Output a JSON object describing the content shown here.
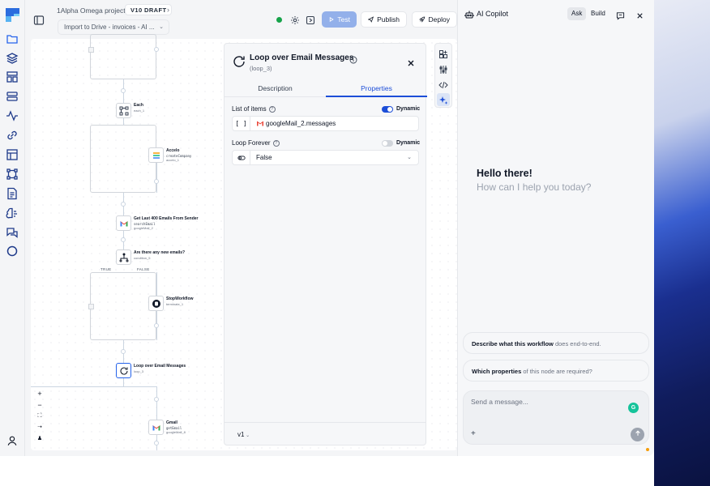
{
  "project": {
    "name": "1Alpha Omega project",
    "version_badge": "V10  DRAFT",
    "flow_name": "Import to Drive - invoices - AI ..."
  },
  "toolbar": {
    "test_label": "Test",
    "publish_label": "Publish",
    "deploy_label": "Deploy"
  },
  "sidebar": {
    "items": [
      {
        "icon": "folder-icon"
      },
      {
        "icon": "layers-icon"
      },
      {
        "icon": "layout-icon"
      },
      {
        "icon": "server-icon"
      },
      {
        "icon": "activity-icon"
      },
      {
        "icon": "link-icon"
      },
      {
        "icon": "table-icon"
      },
      {
        "icon": "nodes-icon"
      },
      {
        "icon": "document-icon"
      },
      {
        "icon": "brain-icon"
      },
      {
        "icon": "chat-icon"
      },
      {
        "icon": "circle-icon"
      }
    ],
    "user_icon": "user-icon"
  },
  "canvas": {
    "nodes": [
      {
        "title": "Each",
        "sub": "each_1"
      },
      {
        "title": "Accelo",
        "mono": "createCompany",
        "sub": "accelo_1"
      },
      {
        "title": "Get Last 400 Emails From Sender",
        "mono": "searchEmail",
        "sub": "googleMail_2"
      },
      {
        "title": "Are there any new emails?",
        "sub": "condition_5"
      },
      {
        "title": "StopWorkflow",
        "sub": "terminate_1"
      },
      {
        "title": "Loop over Email Messages",
        "sub": "loop_3"
      },
      {
        "title": "Gmail",
        "mono": "getEmail",
        "sub": "googleMail_8"
      }
    ],
    "branch_true": "TRUE",
    "branch_false": "FALSE",
    "zoom": {
      "in": "+",
      "out": "−",
      "fit": "⛶",
      "pan": "➝",
      "lock": "♟"
    }
  },
  "properties": {
    "title": "Loop over Email Messages",
    "subtitle": "(loop_3)",
    "tabs": [
      {
        "label": "Description",
        "active": false
      },
      {
        "label": "Properties",
        "active": true
      }
    ],
    "fields": [
      {
        "label": "List of items",
        "dynamic": true,
        "dynamic_label": "Dynamic",
        "prefix": "[ ]",
        "value": "googleMail_2.messages"
      },
      {
        "label": "Loop Forever",
        "dynamic": false,
        "dynamic_label": "Dynamic",
        "value": "False"
      }
    ],
    "version": "v1"
  },
  "copilot": {
    "title": "AI Copilot",
    "modes": [
      {
        "label": "Ask",
        "active": true
      },
      {
        "label": "Build",
        "active": false
      }
    ],
    "greeting": "Hello there!",
    "greeting_sub": "How can I help you today?",
    "suggestions": [
      {
        "bold": "Describe what this workflow",
        "rest": " does end-to-end."
      },
      {
        "bold": "Which properties",
        "rest": " of this node are required?"
      }
    ],
    "composer_placeholder": "Send a message...",
    "grammarly_letter": "G"
  },
  "colors": {
    "accent": "#1d4ed8",
    "status_ok": "#16a34a",
    "test_button": "#93b0ea"
  }
}
